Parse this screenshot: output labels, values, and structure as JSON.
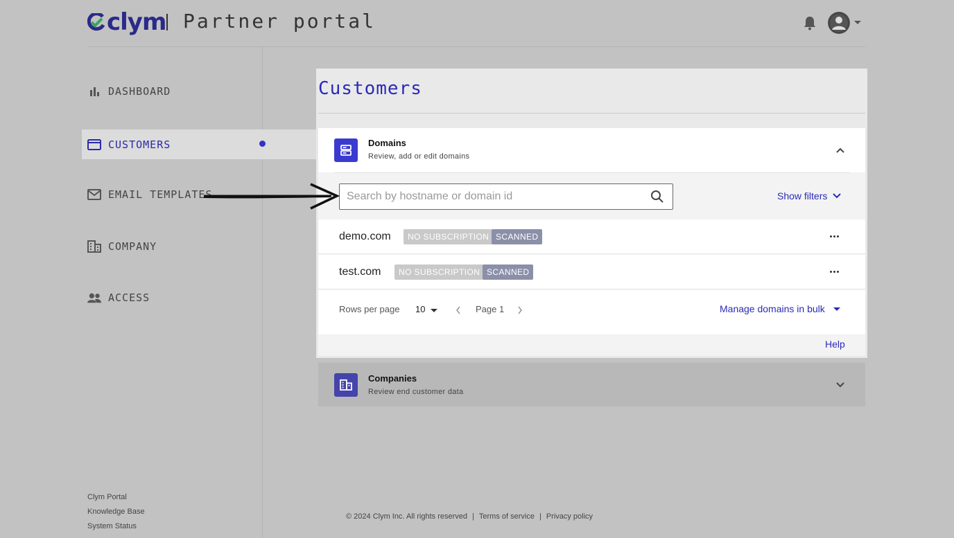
{
  "header": {
    "logo_text": "clym",
    "portal_title": "Partner portal"
  },
  "sidebar": {
    "items": [
      {
        "label": "DASHBOARD",
        "icon": "bar-chart-icon"
      },
      {
        "label": "CUSTOMERS",
        "icon": "folder-icon",
        "active": true
      },
      {
        "label": "EMAIL TEMPLATES",
        "icon": "mail-icon"
      },
      {
        "label": "COMPANY",
        "icon": "building-icon"
      },
      {
        "label": "ACCESS",
        "icon": "people-icon"
      }
    ],
    "footer_links": [
      "Clym Portal",
      "Knowledge Base",
      "System Status"
    ]
  },
  "main": {
    "title": "Customers",
    "domains_card": {
      "title": "Domains",
      "subtitle": "Review, add or edit domains",
      "search_placeholder": "Search by hostname or domain id",
      "show_filters": "Show filters",
      "rows": [
        {
          "domain": "demo.com",
          "badges": [
            "NO SUBSCRIPTION",
            "SCANNED"
          ]
        },
        {
          "domain": "test.com",
          "badges": [
            "NO SUBSCRIPTION",
            "SCANNED"
          ]
        }
      ],
      "rows_per_page_label": "Rows per page",
      "rows_per_page_value": "10",
      "page_label": "Page 1",
      "bulk_label": "Manage domains in bulk",
      "help_label": "Help"
    },
    "companies_card": {
      "title": "Companies",
      "subtitle": "Review end customer data"
    }
  },
  "footer": {
    "copyright": "© 2024 Clym Inc. All rights reserved",
    "terms": "Terms of service",
    "privacy": "Privacy policy"
  },
  "colors": {
    "accent": "#2a2ab8",
    "background": "#c2c2c2"
  }
}
